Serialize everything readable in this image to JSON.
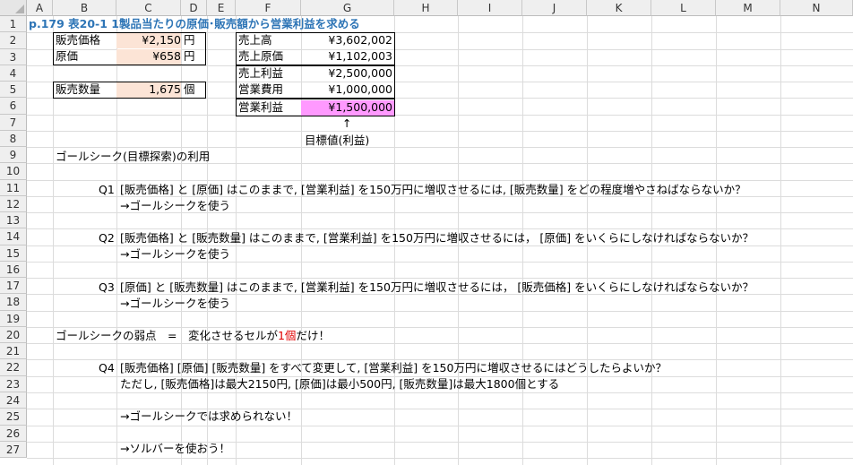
{
  "columns": [
    "A",
    "B",
    "C",
    "D",
    "E",
    "F",
    "G",
    "H",
    "I",
    "J",
    "K",
    "L",
    "M",
    "N"
  ],
  "rows": [
    "1",
    "2",
    "3",
    "4",
    "5",
    "6",
    "7",
    "8",
    "9",
    "10",
    "11",
    "12",
    "13",
    "14",
    "15",
    "16",
    "17",
    "18",
    "19",
    "20",
    "21",
    "22",
    "23",
    "24",
    "25",
    "26",
    "27"
  ],
  "title": "p.179  表20-1  1製品当たりの原価･販売額から営業利益を求める",
  "inputs": {
    "price_label": "販売価格",
    "price_value": "¥2,150",
    "price_unit": "円",
    "cost_label": "原価",
    "cost_value": "¥658",
    "cost_unit": "円",
    "qty_label": "販売数量",
    "qty_value": "1,675",
    "qty_unit": "個"
  },
  "results": {
    "sales_label": "売上高",
    "sales_value": "¥3,602,002",
    "cogs_label": "売上原価",
    "cogs_value": "¥1,102,003",
    "gross_label": "売上利益",
    "gross_value": "¥2,500,000",
    "opex_label": "営業費用",
    "opex_value": "¥1,000,000",
    "op_label": "営業利益",
    "op_value": "¥1,500,000"
  },
  "arrow": "↑",
  "target_label": "目標値(利益)",
  "r9": "ゴールシーク(目標探索)の利用",
  "q1_no": "Q1",
  "q1": "[販売価格] と [原価] はこのままで, [営業利益] を150万円に増収させるには, [販売数量] をどの程度増やさねばならないか？",
  "q1_hint": "→ゴールシークを使う",
  "q2_no": "Q2",
  "q2": "[販売価格] と [販売数量] はこのままで, [営業利益] を150万円に増収させるには， [原価]  をいくらにしなければならないか？",
  "q2_hint": "→ゴールシークを使う",
  "q3_no": "Q3",
  "q3": "[原価] と [販売数量] はこのままで, [営業利益] を150万円に増収させるには， [販売価格]  をいくらにしなければならないか？",
  "q3_hint": "→ゴールシークを使う",
  "weak_a": "ゴールシークの弱点　=　変化させるセルが",
  "weak_red": "1個",
  "weak_b": "だけ！",
  "q4_no": "Q4",
  "q4": "[販売価格] [原価] [販売数量] をすべて変更して, [営業利益] を150万円に増収させるにはどうしたらよいか？",
  "q4_cond": "ただし, [販売価格]は最大2150円, [原価]は最小500円, [販売数量]は最大1800個とする",
  "r25": "→ゴールシークでは求められない！",
  "r27": "→ソルバーを使おう！"
}
